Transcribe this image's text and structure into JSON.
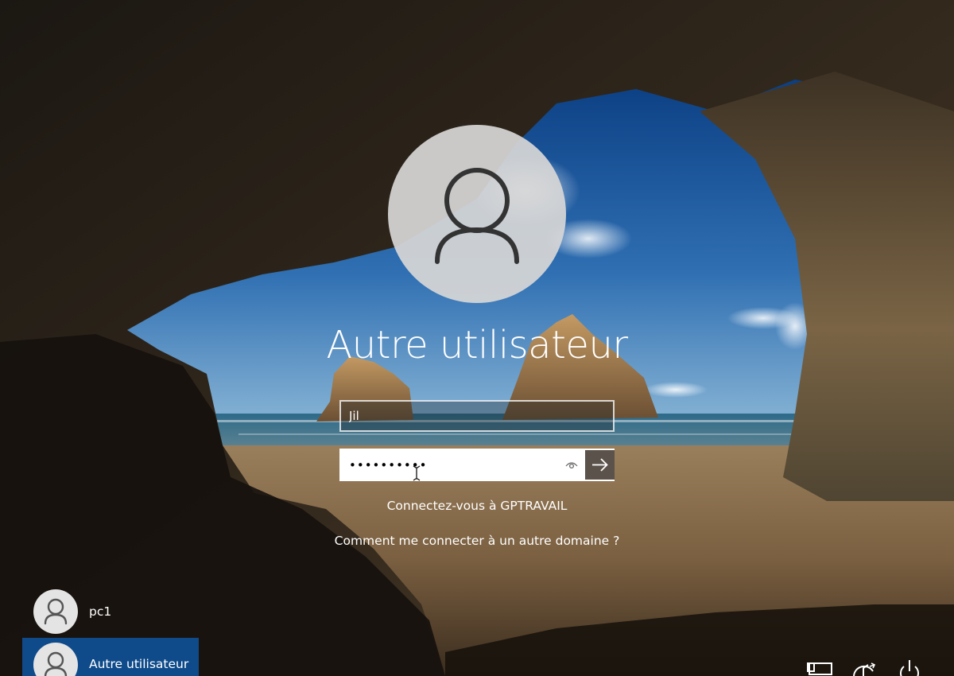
{
  "login": {
    "user_title": "Autre utilisateur",
    "username_value": "Jil",
    "password_value": "••••••••••",
    "domain_text": "Connectez-vous à GPTRAVAIL",
    "other_domain_link": "Comment me connecter à un autre domaine ?",
    "submit_icon": "arrow-right-icon",
    "reveal_icon": "eye-icon"
  },
  "users": [
    {
      "label": "pc1",
      "icon": "user-icon"
    },
    {
      "label": "Autre utilisateur",
      "icon": "user-icon"
    }
  ],
  "system_icons": [
    "network-icon",
    "accessibility-icon",
    "power-icon"
  ],
  "colors": {
    "selected_user_bg": "#0f4b8a",
    "submit_button_bg": "#5b524b",
    "avatar_bg": "#d6d6d6",
    "text": "#ffffff"
  }
}
